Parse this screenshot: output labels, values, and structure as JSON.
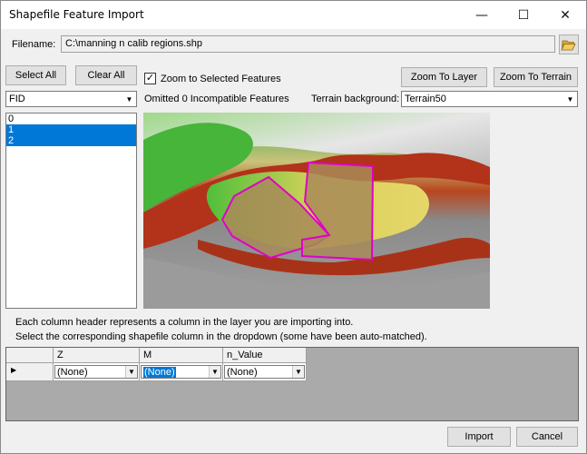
{
  "window": {
    "title": "Shapefile Feature Import",
    "minimize_glyph": "—",
    "maximize_glyph": "☐",
    "close_glyph": "✕"
  },
  "filename": {
    "label": "Filename:",
    "value": "C:\\manning n calib regions.shp",
    "browse_icon": "folder-open-icon"
  },
  "toolbar": {
    "select_all": "Select All",
    "clear_all": "Clear All",
    "zoom_to_selected_label": "Zoom to Selected Features",
    "zoom_to_selected_checked": true,
    "zoom_to_layer": "Zoom To Layer",
    "zoom_to_terrain": "Zoom To Terrain"
  },
  "field_select": {
    "value": "FID"
  },
  "omitted_text": "Omitted 0 Incompatible Features",
  "terrain": {
    "label": "Terrain background:",
    "value": "Terrain50"
  },
  "feature_list": {
    "items": [
      {
        "label": "0",
        "selected": false
      },
      {
        "label": "1",
        "selected": true
      },
      {
        "label": "2",
        "selected": true
      }
    ]
  },
  "instructions": {
    "line1": "Each column header represents a column in the layer you are importing into.",
    "line2": "Select the corresponding shapefile column in the dropdown (some have been auto-matched)."
  },
  "mapping_grid": {
    "row_indicator": "▶",
    "columns": [
      {
        "header": "Z",
        "value": "(None)",
        "highlighted": false
      },
      {
        "header": "M",
        "value": "(None)",
        "highlighted": true
      },
      {
        "header": "n_Value",
        "value": "(None)",
        "highlighted": false
      }
    ]
  },
  "footer": {
    "import": "Import",
    "cancel": "Cancel"
  },
  "colors": {
    "selection": "#0078d7",
    "polygon_outline": "#e000c8",
    "polygon_fill": "#a88a58"
  }
}
